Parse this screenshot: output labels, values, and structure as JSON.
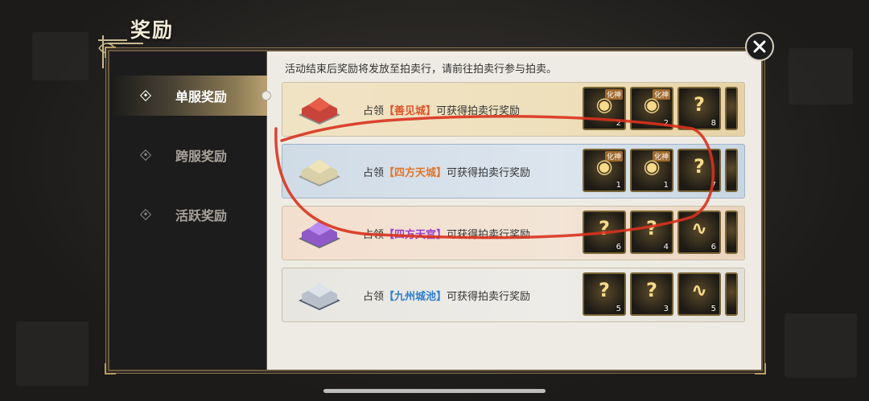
{
  "window": {
    "title": "奖励"
  },
  "notice": "活动结束后奖励将发放至拍卖行，请前往拍卖行参与拍卖。",
  "sidebar": {
    "items": [
      {
        "label": "单服奖励",
        "active": true
      },
      {
        "label": "跨服奖励",
        "active": false
      },
      {
        "label": "活跃奖励",
        "active": false
      }
    ]
  },
  "rows": [
    {
      "prefix": "占领",
      "city": "【善见城】",
      "city_color": "#e0542a",
      "suffix": "可获得拍卖行奖励",
      "items": [
        {
          "tag": "化神",
          "count": "2"
        },
        {
          "tag": "化神",
          "count": "2"
        },
        {
          "tag": "",
          "count": "8"
        }
      ]
    },
    {
      "prefix": "占领",
      "city": "【四方天城】",
      "city_color": "#e0752a",
      "suffix": "可获得拍卖行奖励",
      "items": [
        {
          "tag": "化神",
          "count": "1"
        },
        {
          "tag": "化神",
          "count": "1"
        },
        {
          "tag": "",
          "count": "7"
        }
      ]
    },
    {
      "prefix": "占领",
      "city": "【四方天宫】",
      "city_color": "#9b3fc8",
      "suffix": "可获得拍卖行奖励",
      "items": [
        {
          "tag": "",
          "count": "6"
        },
        {
          "tag": "",
          "count": "4"
        },
        {
          "tag": "",
          "count": "6"
        }
      ]
    },
    {
      "prefix": "占领",
      "city": "【九州城池】",
      "city_color": "#2f7ed0",
      "suffix": "可获得拍卖行奖励",
      "items": [
        {
          "tag": "",
          "count": "5"
        },
        {
          "tag": "",
          "count": "3"
        },
        {
          "tag": "",
          "count": "5"
        }
      ]
    }
  ],
  "colors": {
    "accent_gold": "#b89d62",
    "annotation_red": "#d9321e"
  },
  "icons": {
    "close": "close-icon",
    "diamond": "diamond-icon",
    "item": "reward-item-icon"
  }
}
